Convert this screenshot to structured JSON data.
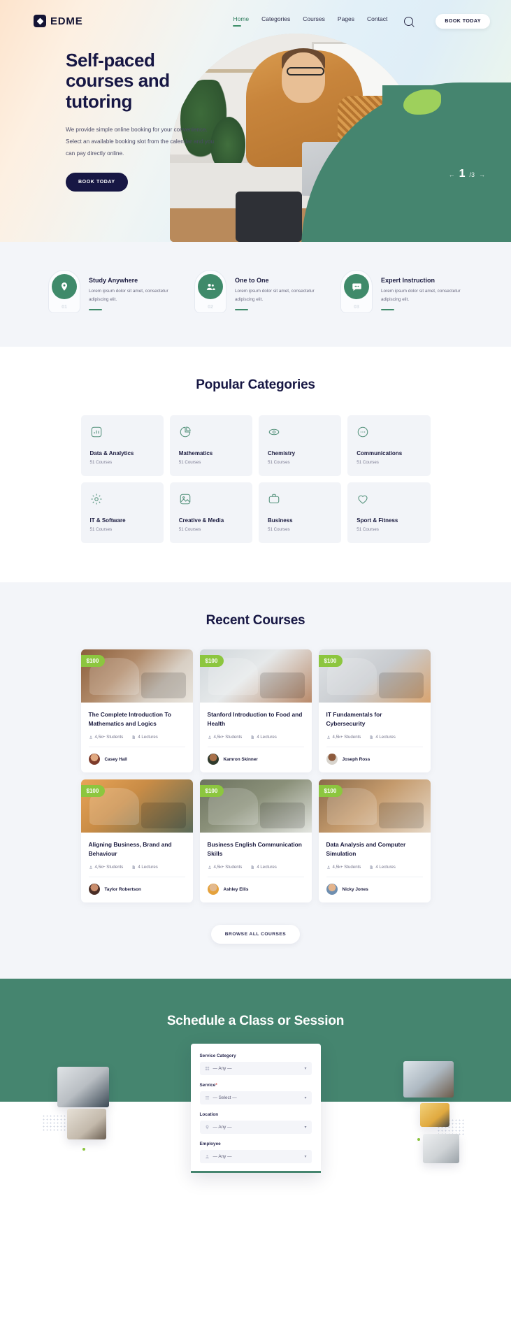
{
  "brand": {
    "name": "EDME",
    "logo_icon": "diamond-badge-icon"
  },
  "nav": {
    "links": [
      {
        "label": "Home",
        "active": true
      },
      {
        "label": "Categories",
        "active": false
      },
      {
        "label": "Courses",
        "active": false
      },
      {
        "label": "Pages",
        "active": false
      },
      {
        "label": "Contact",
        "active": false
      }
    ],
    "search_icon": "search-icon",
    "cta_label": "BOOK TODAY"
  },
  "hero": {
    "title_line1": "Self-paced",
    "title_line2": "courses and",
    "title_line3": "tutoring",
    "subtitle": "We provide simple online booking for your convenience. Select an available booking slot from the calendar and you can pay directly online.",
    "cta_label": "BOOK TODAY",
    "slider": {
      "current": "1",
      "total": "/3",
      "prev_icon": "arrow-left-icon",
      "next_icon": "arrow-right-icon"
    }
  },
  "features": [
    {
      "num": "01",
      "icon": "location-pin-icon",
      "title": "Study Anywhere",
      "desc": "Lorem ipsum dolor sit amet, consectetur adipiscing elit."
    },
    {
      "num": "02",
      "icon": "people-icon",
      "title": "One to One",
      "desc": "Lorem ipsum dolor sit amet, consectetur adipiscing elit."
    },
    {
      "num": "03",
      "icon": "chat-bubble-icon",
      "title": "Expert Instruction",
      "desc": "Lorem ipsum dolor sit amet, consectetur adipiscing elit."
    }
  ],
  "categories": {
    "title": "Popular Categories",
    "items": [
      {
        "icon": "bar-chart-icon",
        "name": "Data & Analytics",
        "count": "51 Courses"
      },
      {
        "icon": "pie-chart-icon",
        "name": "Mathematics",
        "count": "51 Courses"
      },
      {
        "icon": "atom-icon",
        "name": "Chemistry",
        "count": "51 Courses"
      },
      {
        "icon": "chat-dots-icon",
        "name": "Communications",
        "count": "51 Courses"
      },
      {
        "icon": "gear-icon",
        "name": "IT & Software",
        "count": "51 Courses"
      },
      {
        "icon": "image-icon",
        "name": "Creative & Media",
        "count": "51 Courses"
      },
      {
        "icon": "briefcase-icon",
        "name": "Business",
        "count": "51 Courses"
      },
      {
        "icon": "heart-icon",
        "name": "Sport & Fitness",
        "count": "51 Courses"
      }
    ]
  },
  "courses": {
    "title": "Recent Courses",
    "browse_label": "BROWSE ALL COURSES",
    "items": [
      {
        "price": "$100",
        "title": "The Complete Introduction To Mathematics and Logics",
        "students": "4,5k+ Students",
        "lectures": "4 Lectures",
        "author": "Casey Hall"
      },
      {
        "price": "$100",
        "title": "Stanford Introduction to Food and Health",
        "students": "4,5k+ Students",
        "lectures": "4 Lectures",
        "author": "Kamron Skinner"
      },
      {
        "price": "$100",
        "title": "IT Fundamentals for Cybersecurity",
        "students": "4,5k+ Students",
        "lectures": "4 Lectures",
        "author": "Joseph Ross"
      },
      {
        "price": "$100",
        "title": "Aligning Business, Brand and Behaviour",
        "students": "4,5k+ Students",
        "lectures": "4 Lectures",
        "author": "Taylor Robertson"
      },
      {
        "price": "$100",
        "title": "Business English Communication Skills",
        "students": "4,5k+ Students",
        "lectures": "4 Lectures",
        "author": "Ashley Ellis"
      },
      {
        "price": "$100",
        "title": "Data Analysis and Computer Simulation",
        "students": "4,5k+ Students",
        "lectures": "4 Lectures",
        "author": "Nicky Jones"
      }
    ]
  },
  "schedule": {
    "title": "Schedule a Class or Session",
    "form": {
      "fields": [
        {
          "label": "Service Category",
          "required": false,
          "icon": "grid-icon",
          "value": "— Any —"
        },
        {
          "label": "Service",
          "required": true,
          "icon": "list-icon",
          "value": "— Select —"
        },
        {
          "label": "Location",
          "required": false,
          "icon": "location-pin-icon",
          "value": "— Any —"
        },
        {
          "label": "Employee",
          "required": false,
          "icon": "user-icon",
          "value": "— Any —"
        }
      ],
      "caret_icon": "chevron-down-icon"
    }
  },
  "colors": {
    "green": "#45856f",
    "lime": "#8cc63f",
    "navy": "#171744",
    "grey_bg": "#f3f5f9"
  }
}
